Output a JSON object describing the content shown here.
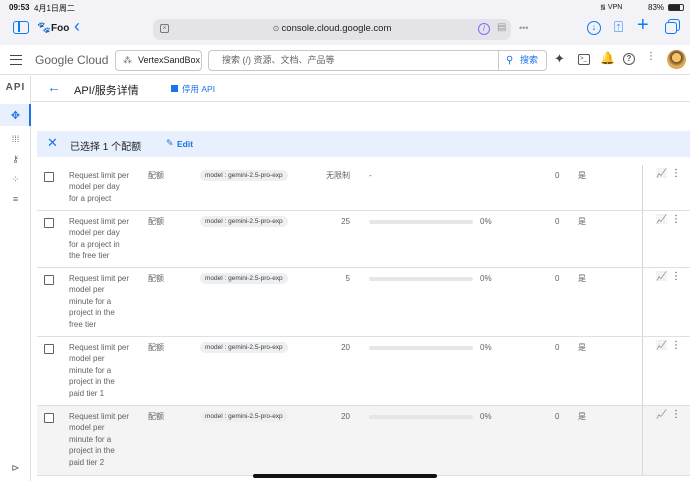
{
  "status": {
    "time": "09:53",
    "date": "4月1日周二",
    "battery": "83%"
  },
  "browser": {
    "profile": "Foo",
    "url": "console.cloud.google.com"
  },
  "header": {
    "logo": "Google Cloud",
    "project": "VertexSandBox",
    "search_placeholder": "搜索 (/) 资源、文档、产品等",
    "search_button": "搜索"
  },
  "rail": {
    "label": "API"
  },
  "page": {
    "title": "API/服务详情",
    "disable": "停用 API"
  },
  "selection": {
    "text": "已选择 1 个配额",
    "edit": "Edit"
  },
  "rows": [
    {
      "name": [
        "Request limit per",
        "model per day",
        "for a project"
      ],
      "type": "配额",
      "chip": "model : gemini-2.5-pro-exp",
      "value": "无限制",
      "pct": "-",
      "usage": 0,
      "usage_text": "0",
      "adjustable": "是",
      "checked": false
    },
    {
      "name": [
        "Request limit per",
        "model per day",
        "for a project in",
        "the free tier"
      ],
      "type": "配额",
      "chip": "model : gemini-2.5-pro-exp",
      "value": "25",
      "pct": "0%",
      "usage": 0,
      "usage_text": "0",
      "adjustable": "是",
      "checked": false
    },
    {
      "name": [
        "Request limit per",
        "model per",
        "minute for a",
        "project in the",
        "free tier"
      ],
      "type": "配额",
      "chip": "model : gemini-2.5-pro-exp",
      "value": "5",
      "pct": "0%",
      "usage": 0,
      "usage_text": "0",
      "adjustable": "是",
      "checked": false
    },
    {
      "name": [
        "Request limit per",
        "model per",
        "minute for a",
        "project in the",
        "paid tier 1"
      ],
      "type": "配额",
      "chip": "model : gemini-2.5-pro-exp",
      "value": "20",
      "pct": "0%",
      "usage": 0,
      "usage_text": "0",
      "adjustable": "是",
      "checked": false
    },
    {
      "name": [
        "Request limit per",
        "model per",
        "minute for a",
        "project in the",
        "paid tier 2"
      ],
      "type": "配额",
      "chip": "model : gemini-2.5-pro-exp",
      "value": "20",
      "pct": "0%",
      "usage": 0,
      "usage_text": "0",
      "adjustable": "是",
      "checked": false
    }
  ],
  "colors": {
    "accent": "#1a73e8",
    "selbar": "#e8f0fe",
    "safari_blue": "#0a7aff"
  },
  "icons": {
    "rail": [
      "diamond-move-icon",
      "grid-icon",
      "key-icon",
      "dots-icon",
      "list-settings-icon"
    ]
  }
}
